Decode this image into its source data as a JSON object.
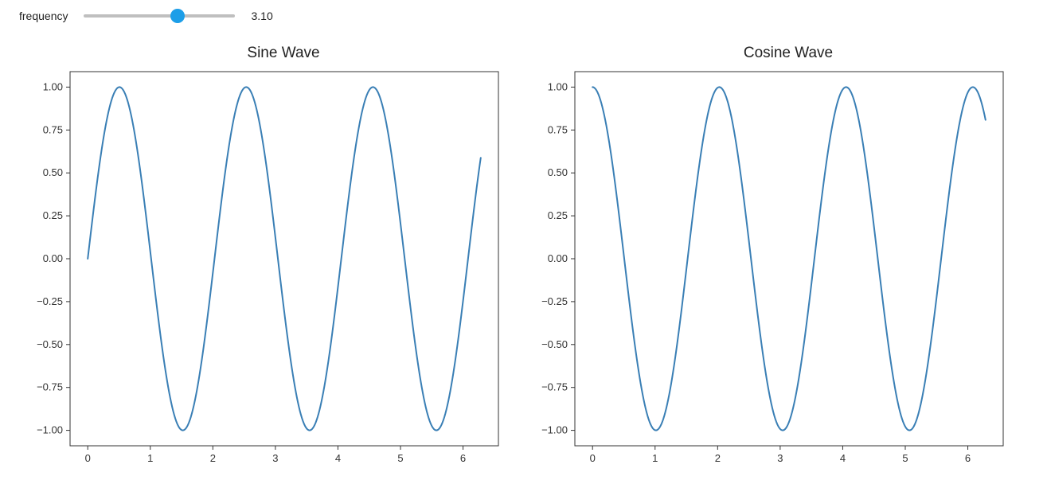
{
  "control": {
    "label": "frequency",
    "value_text": "3.10",
    "value": 3.1,
    "min": 0.0,
    "max": 5.0
  },
  "chart_data": [
    {
      "type": "line",
      "title": "Sine Wave",
      "xlabel": "",
      "ylabel": "",
      "xlim": [
        0,
        6.2832
      ],
      "ylim": [
        -1,
        1
      ],
      "function": "sin",
      "frequency": 3.1,
      "x_ticks": [
        0,
        1,
        2,
        3,
        4,
        5,
        6
      ],
      "y_ticks": [
        -1.0,
        -0.75,
        -0.5,
        -0.25,
        0.0,
        0.25,
        0.5,
        0.75,
        1.0
      ],
      "y_tick_labels": [
        "−1.00",
        "−0.75",
        "−0.50",
        "−0.25",
        "0.00",
        "0.25",
        "0.50",
        "0.75",
        "1.00"
      ]
    },
    {
      "type": "line",
      "title": "Cosine Wave",
      "xlabel": "",
      "ylabel": "",
      "xlim": [
        0,
        6.2832
      ],
      "ylim": [
        -1,
        1
      ],
      "function": "cos",
      "frequency": 3.1,
      "x_ticks": [
        0,
        1,
        2,
        3,
        4,
        5,
        6
      ],
      "y_ticks": [
        -1.0,
        -0.75,
        -0.5,
        -0.25,
        0.0,
        0.25,
        0.5,
        0.75,
        1.0
      ],
      "y_tick_labels": [
        "−1.00",
        "−0.75",
        "−0.50",
        "−0.25",
        "0.00",
        "0.25",
        "0.50",
        "0.75",
        "1.00"
      ]
    }
  ],
  "colors": {
    "line": "#3a7fb5",
    "slider_thumb": "#1c9ee8",
    "slider_track": "#bfbfbf"
  }
}
